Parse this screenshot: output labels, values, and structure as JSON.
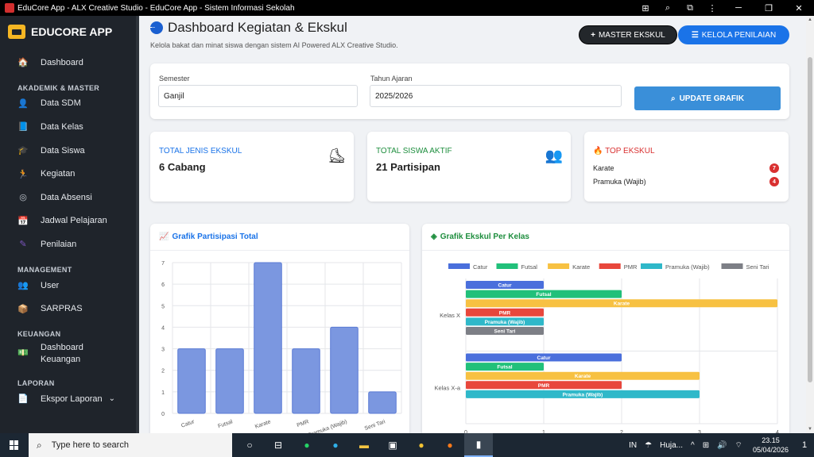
{
  "window": {
    "title": "EduCore App - ALX Creative Studio - EduCore App - Sistem Informasi Sekolah"
  },
  "sidebar": {
    "brand": "EDUCORE APP",
    "items": [
      {
        "type": "item",
        "label": "Dashboard",
        "icon": "home-icon",
        "glyph": "🏠",
        "color": "#4fc3f7"
      },
      {
        "type": "head",
        "label": "AKADEMIK & MASTER"
      },
      {
        "type": "item",
        "label": "Data SDM",
        "icon": "user-tie-icon",
        "glyph": "👤",
        "color": "#4fc3f7"
      },
      {
        "type": "item",
        "label": "Data Kelas",
        "icon": "book-icon",
        "glyph": "📘",
        "color": "#1e88e5"
      },
      {
        "type": "item",
        "label": "Data Siswa",
        "icon": "graduation-icon",
        "glyph": "🎓",
        "color": "#f5b623"
      },
      {
        "type": "item",
        "label": "Kegiatan",
        "icon": "running-icon",
        "glyph": "🏃",
        "color": "#4fc3f7"
      },
      {
        "type": "item",
        "label": "Data Absensi",
        "icon": "fingerprint-icon",
        "glyph": "◎",
        "color": "#c0c6ce"
      },
      {
        "type": "item",
        "label": "Jadwal Pelajaran",
        "icon": "calendar-icon",
        "glyph": "📅",
        "color": "#e53935"
      },
      {
        "type": "item",
        "label": "Penilaian",
        "icon": "pen-icon",
        "glyph": "✎",
        "color": "#7e57c2"
      },
      {
        "type": "head",
        "label": "MANAGEMENT"
      },
      {
        "type": "item",
        "label": "User",
        "icon": "users-icon",
        "glyph": "👥",
        "color": "#43a047"
      },
      {
        "type": "item",
        "label": "SARPRAS",
        "icon": "box-icon",
        "glyph": "📦",
        "color": "#f5b623"
      },
      {
        "type": "head",
        "label": "KEUANGAN"
      },
      {
        "type": "item2",
        "label": "Dashboard Keuangan",
        "icon": "money-icon",
        "glyph": "💵",
        "color": "#43a047"
      },
      {
        "type": "head",
        "label": "LAPORAN"
      },
      {
        "type": "item",
        "label": "Ekspor Laporan",
        "icon": "file-export-icon",
        "glyph": "📄",
        "color": "#c0c6ce",
        "chevron": true
      }
    ]
  },
  "header": {
    "title": "Dashboard Kegiatan & Ekskul",
    "subtitle": "Kelola bakat dan minat siswa dengan sistem AI Powered ALX Creative Studio.",
    "btn_master": "MASTER EKSKUL",
    "btn_kelola": "KELOLA PENILAIAN"
  },
  "filter": {
    "semester_label": "Semester",
    "semester_value": "Ganjil",
    "tahun_label": "Tahun Ajaran",
    "tahun_value": "2025/2026",
    "update_label": "UPDATE GRAFIK"
  },
  "stats": {
    "jenis_label": "TOTAL JENIS EKSKUL",
    "jenis_value": "6 Cabang",
    "siswa_label": "TOTAL SISWA AKTIF",
    "siswa_value": "21 Partisipan",
    "top_label": "TOP EKSKUL",
    "top": [
      {
        "name": "Karate",
        "count": "7"
      },
      {
        "name": "Pramuka (Wajib)",
        "count": "4"
      }
    ],
    "colors": {
      "blue": "#1a73e8",
      "green": "#1e8e3e",
      "red": "#d93030"
    }
  },
  "chart1_title": "Grafik Partisipasi Total",
  "chart2_title": "Grafik Ekskul Per Kelas",
  "chart_data": [
    {
      "type": "bar",
      "categories": [
        "Catur",
        "Futsal",
        "Karate",
        "PMR",
        "Pramuka (Wajib)",
        "Seni Tari"
      ],
      "values": [
        3,
        3,
        7,
        3,
        4,
        1
      ],
      "ylim": [
        0,
        7
      ],
      "yticks": [
        0,
        1,
        2,
        3,
        4,
        5,
        6,
        7
      ],
      "color": "#7b97e0",
      "grid": true
    },
    {
      "type": "bar",
      "orientation": "horizontal",
      "categories": [
        "Kelas X",
        "Kelas X-a"
      ],
      "series": [
        {
          "name": "Catur",
          "color": "#4a6fdc",
          "values": [
            1,
            2
          ]
        },
        {
          "name": "Futsal",
          "color": "#21c07a",
          "values": [
            2,
            1
          ]
        },
        {
          "name": "Karate",
          "color": "#f7c142",
          "values": [
            4,
            3
          ]
        },
        {
          "name": "PMR",
          "color": "#e8473c",
          "values": [
            1,
            2
          ]
        },
        {
          "name": "Pramuka (Wajib)",
          "color": "#2fb8c9",
          "values": [
            1,
            3
          ]
        },
        {
          "name": "Seni Tari",
          "color": "#7d7f86",
          "values": [
            1,
            0
          ]
        }
      ],
      "xlim": [
        0,
        4
      ],
      "xticks": [
        0,
        1,
        2,
        3,
        4
      ],
      "legend": "top",
      "grid": true
    }
  ],
  "taskbar": {
    "search_placeholder": "Type here to search",
    "weather": "Huja...",
    "lang": "IN",
    "time": "23.15",
    "date": "05/04/2026",
    "notif_count": "1"
  }
}
